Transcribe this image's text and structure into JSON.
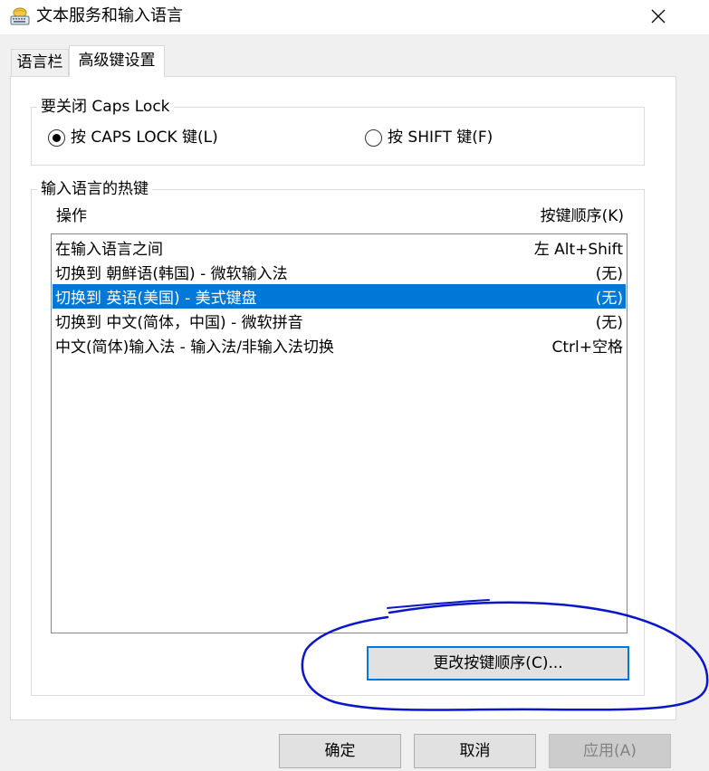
{
  "window": {
    "title": "文本服务和输入语言",
    "icon": "keyboard-globe-icon"
  },
  "tabs": [
    {
      "label": "语言栏",
      "active": false
    },
    {
      "label": "高级键设置",
      "active": true
    }
  ],
  "caps_lock_group": {
    "legend": "要关闭 Caps Lock",
    "options": [
      {
        "label": "按 CAPS LOCK 键(L)",
        "checked": true
      },
      {
        "label": "按 SHIFT 键(F)",
        "checked": false
      }
    ]
  },
  "hotkeys_group": {
    "legend": "输入语言的热键",
    "columns": {
      "action": "操作",
      "key_sequence": "按键顺序(K)"
    },
    "rows": [
      {
        "action": "在输入语言之间",
        "keys": "左 Alt+Shift",
        "selected": false
      },
      {
        "action": "切换到 朝鲜语(韩国) - 微软输入法",
        "keys": "(无)",
        "selected": false
      },
      {
        "action": "切换到 英语(美国) - 美式键盘",
        "keys": "(无)",
        "selected": true
      },
      {
        "action": "切换到 中文(简体，中国) - 微软拼音",
        "keys": "(无)",
        "selected": false
      },
      {
        "action": "中文(简体)输入法 - 输入法/非输入法切换",
        "keys": "Ctrl+空格",
        "selected": false
      }
    ],
    "change_button": "更改按键顺序(C)..."
  },
  "footer": {
    "ok": "确定",
    "cancel": "取消",
    "apply": "应用(A)",
    "apply_enabled": false
  },
  "colors": {
    "selection": "#0078d7",
    "annotation": "#0b16c8"
  }
}
